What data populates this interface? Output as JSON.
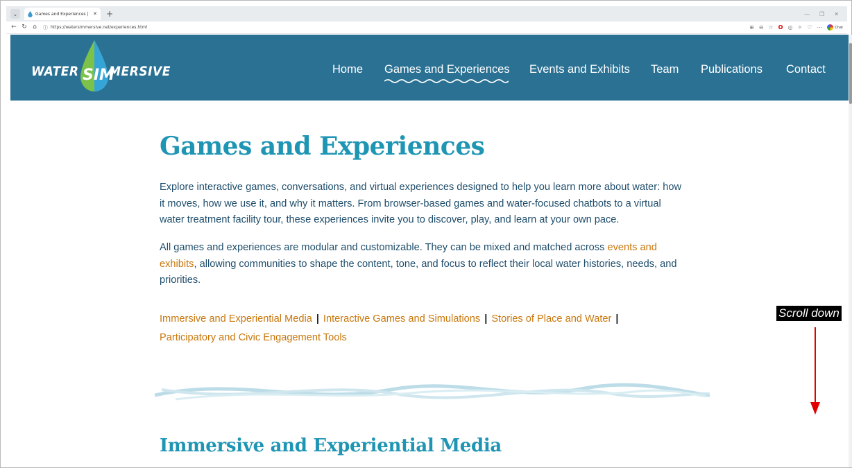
{
  "browser": {
    "tab_title": "Games and Experiences | WaterSi",
    "tab_close": "✕",
    "new_tab": "+",
    "url": "https://watersimmersive.net/experiences.html",
    "chat_label": "Chat"
  },
  "site": {
    "logo_left": "WATER",
    "logo_mid": "SIM",
    "logo_right": "MERSIVE",
    "header_color": "#2a7193",
    "nav": [
      {
        "label": "Home"
      },
      {
        "label": "Games and Experiences",
        "active": true
      },
      {
        "label": "Events and Exhibits"
      },
      {
        "label": "Team"
      },
      {
        "label": "Publications"
      },
      {
        "label": "Contact"
      }
    ]
  },
  "main": {
    "title": "Games and Experiences",
    "para1": "Explore interactive games, conversations, and virtual experiences designed to help you learn more about water: how it moves, how we use it, and why it matters. From browser-based games and water-focused chatbots to a virtual water treatment facility tour, these experiences invite you to discover, play, and learn at your own pace.",
    "para2_before": "All games and experiences are modular and customizable. They can be mixed and matched across ",
    "para2_link": "events and exhibits",
    "para2_after": ", allowing communities to shape the content, tone, and focus to reflect their local water histories, needs, and priorities.",
    "categories": [
      "Immersive and Experiential Media",
      "Interactive Games and Simulations",
      "Stories of Place and Water",
      "Participatory and Civic Engagement Tools"
    ],
    "separator": "|",
    "section_title": "Immersive and Experiential Media"
  },
  "annotation": {
    "scroll_hint": "Scroll down"
  },
  "colors": {
    "title": "#1f95b4",
    "body_text": "#1e4d6b",
    "link": "#c8770c",
    "annotation_arrow": "#e00000"
  }
}
